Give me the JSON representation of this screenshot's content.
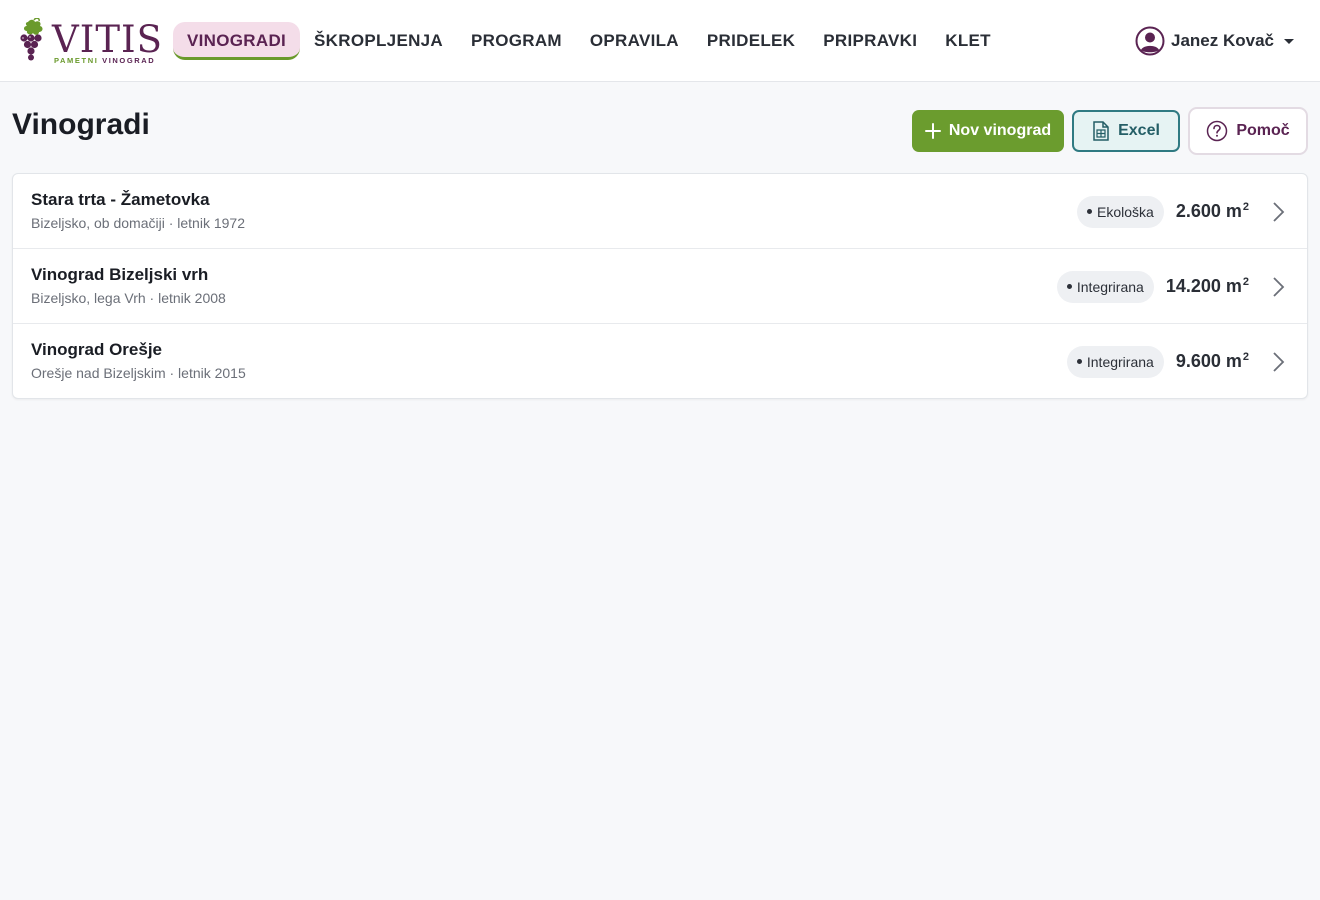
{
  "brand": {
    "name": "VITIS",
    "tagline_a": "PAMETNI",
    "tagline_b": "VINOGRAD",
    "colors": {
      "primary": "#5a2352",
      "accent": "#6b9c2e",
      "teal": "#2f7a82"
    }
  },
  "nav": {
    "items": [
      {
        "label": "VINOGRADI",
        "active": true
      },
      {
        "label": "ŠKROPLJENJA",
        "active": false
      },
      {
        "label": "PROGRAM",
        "active": false
      },
      {
        "label": "OPRAVILA",
        "active": false
      },
      {
        "label": "PRIDELEK",
        "active": false
      },
      {
        "label": "PRIPRAVKI",
        "active": false
      },
      {
        "label": "KLET",
        "active": false
      }
    ]
  },
  "user": {
    "name": "Janez Kovač",
    "icon": "user-circle-icon"
  },
  "page": {
    "title": "Vinogradi",
    "buttons": {
      "new": "Nov vinograd",
      "excel": "Excel",
      "help": "Pomoč"
    }
  },
  "vineyards": [
    {
      "name": "Stara trta - Žametovka",
      "details": "Bizeljsko, ob domačiji · letnik 1972",
      "badge": "Ekološka",
      "area": "2.600 m",
      "unit_sup": "2"
    },
    {
      "name": "Vinograd Bizeljski vrh",
      "details": "Bizeljsko, lega Vrh · letnik 2008",
      "badge": "Integrirana",
      "area": "14.200 m",
      "unit_sup": "2"
    },
    {
      "name": "Vinograd Orešje",
      "details": "Orešje nad Bizeljskim · letnik 2015",
      "badge": "Integrirana",
      "area": "9.600 m",
      "unit_sup": "2"
    }
  ]
}
